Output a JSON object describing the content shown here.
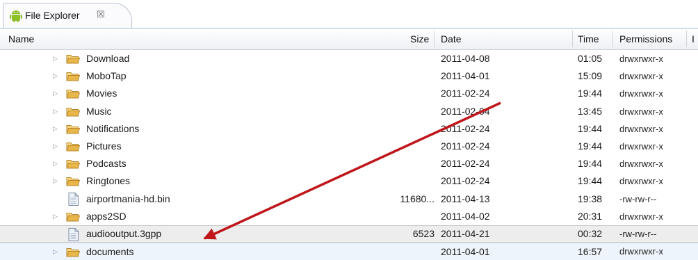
{
  "tab": {
    "title": "File Explorer",
    "close_glyph": "☒",
    "icon": "android-icon"
  },
  "columns": {
    "name": "Name",
    "size": "Size",
    "date": "Date",
    "time": "Time",
    "permissions": "Permissions",
    "extra": "I"
  },
  "rows": [
    {
      "type": "folder",
      "name": "Download",
      "size": "",
      "date": "2011-04-08",
      "time": "01:05",
      "perm": "drwxrwxr-x"
    },
    {
      "type": "folder",
      "name": "MoboTap",
      "size": "",
      "date": "2011-04-01",
      "time": "15:09",
      "perm": "drwxrwxr-x"
    },
    {
      "type": "folder",
      "name": "Movies",
      "size": "",
      "date": "2011-02-24",
      "time": "19:44",
      "perm": "drwxrwxr-x"
    },
    {
      "type": "folder",
      "name": "Music",
      "size": "",
      "date": "2011-02-04",
      "time": "13:45",
      "perm": "drwxrwxr-x"
    },
    {
      "type": "folder",
      "name": "Notifications",
      "size": "",
      "date": "2011-02-24",
      "time": "19:44",
      "perm": "drwxrwxr-x"
    },
    {
      "type": "folder",
      "name": "Pictures",
      "size": "",
      "date": "2011-02-24",
      "time": "19:44",
      "perm": "drwxrwxr-x"
    },
    {
      "type": "folder",
      "name": "Podcasts",
      "size": "",
      "date": "2011-02-24",
      "time": "19:44",
      "perm": "drwxrwxr-x"
    },
    {
      "type": "folder",
      "name": "Ringtones",
      "size": "",
      "date": "2011-02-24",
      "time": "19:44",
      "perm": "drwxrwxr-x"
    },
    {
      "type": "file",
      "name": "airportmania-hd.bin",
      "size": "11680...",
      "date": "2011-04-13",
      "time": "19:38",
      "perm": "-rw-rw-r--"
    },
    {
      "type": "folder",
      "name": "apps2SD",
      "size": "",
      "date": "2011-04-02",
      "time": "20:31",
      "perm": "drwxrwxr-x"
    },
    {
      "type": "file",
      "name": "audiooutput.3gpp",
      "size": "6523",
      "date": "2011-04-21",
      "time": "00:32",
      "perm": "-rw-rw-r--"
    },
    {
      "type": "folder",
      "name": "documents",
      "size": "",
      "date": "2011-04-01",
      "time": "16:57",
      "perm": "drwxrwxr-x"
    }
  ],
  "colors": {
    "folder": "#e9b64a",
    "arrow": "#c0161b",
    "selection": "#ededed",
    "hover": "#eef4fb"
  },
  "icons": {
    "expander": "tree-expander-icon",
    "folder": "folder-icon",
    "file": "file-icon",
    "arrow": "annotation-arrow"
  }
}
